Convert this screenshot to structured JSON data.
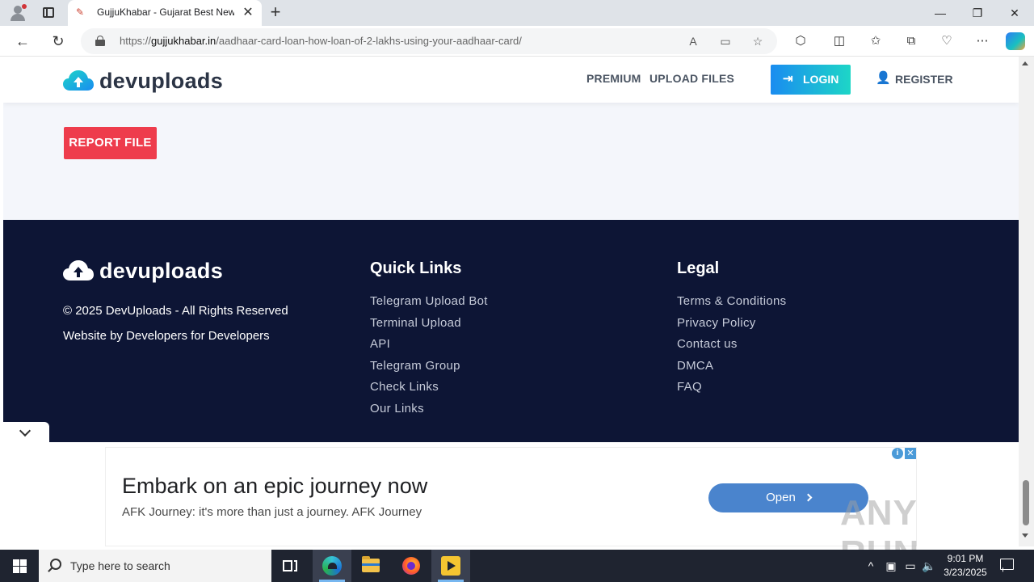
{
  "browser": {
    "tab_title": "GujjuKhabar - Gujarat Best News",
    "tab_favicon": "news-favicon",
    "url_scheme": "https://",
    "url_host": "gujjukhabar.in",
    "url_path": "/aadhaar-card-loan-how-loan-of-2-lakhs-using-your-aadhaar-card/"
  },
  "site": {
    "logo_text": "devuploads",
    "brand_color": "#1a8cf0",
    "accent_color": "#1dd6c7",
    "nav": {
      "premium": "PREMIUM",
      "upload_files": "UPLOAD FILES",
      "login": "LOGIN",
      "register": "REGISTER"
    },
    "report_button": "REPORT FILE",
    "report_color": "#ee3c4c"
  },
  "footer": {
    "logo_text": "devuploads",
    "copyright": "© 2025 DevUploads - All Rights Reserved",
    "byline": "Website by Developers for Developers",
    "quick_links": {
      "title": "Quick Links",
      "items": [
        "Telegram Upload Bot",
        "Terminal Upload",
        "API",
        "Telegram Group",
        "Check Links",
        "Our Links"
      ]
    },
    "legal": {
      "title": "Legal",
      "items": [
        "Terms & Conditions",
        "Privacy Policy",
        "Contact us",
        "DMCA",
        "FAQ"
      ]
    },
    "background": "#0d1535"
  },
  "ad": {
    "headline": "Embark on an epic journey now",
    "subtext": "AFK Journey: it's more than just a journey. AFK Journey",
    "cta": "Open",
    "adchoices_glyph": "i",
    "close_glyph": "✕"
  },
  "watermark": "ANY RUN",
  "taskbar": {
    "search_placeholder": "Type here to search",
    "time": "9:01 PM",
    "date": "3/23/2025"
  }
}
